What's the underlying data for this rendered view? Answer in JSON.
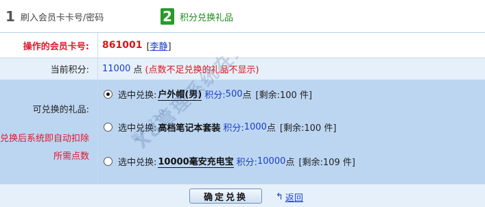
{
  "steps": [
    {
      "num": "1",
      "label": "刷入会员卡卡号/密码"
    },
    {
      "num": "2",
      "label": "积分兑换礼品"
    }
  ],
  "form": {
    "card_label": "操作的会员卡号:",
    "card_number": "861001",
    "member_bracket_open": "[",
    "member_name": "李静",
    "member_bracket_close": "]",
    "points_label": "当前积分:",
    "points_value": "11000",
    "points_unit": "点",
    "points_hint": "(点数不足兑换的礼品不显示)",
    "gift_label": "可兑换的礼品:",
    "auto_note": "兑换后系统即自动扣除所需点数",
    "options": [
      {
        "prefix": "选中兑换:",
        "name": "户外帽(男)",
        "points_label": "积分:",
        "points": "500",
        "unit": "点",
        "remain": "[剩余:100 件]",
        "checked": true
      },
      {
        "prefix": "选中兑换:",
        "name": "高档笔记本套装",
        "points_label": "积分:",
        "points": "1000",
        "unit": "点",
        "remain": "[剩余:100 件]",
        "checked": false
      },
      {
        "prefix": "选中兑换:",
        "name": "10000毫安充电宝",
        "points_label": "积分:",
        "points": "10000",
        "unit": "点",
        "remain": "[剩余:109 件]",
        "checked": false
      }
    ],
    "submit_label": "确定兑换",
    "back_label": "返回"
  },
  "watermark": {
    "text": "X8管理系统在线帮助文档-说明图",
    "version": "版本: 22.0"
  },
  "colors": {
    "accent_red": "#e0162b",
    "link_blue": "#1a3cc8",
    "step_green": "#2a9a2a",
    "options_bg": "#bcd6f2",
    "row_alt_bg": "#e6f0fa"
  },
  "icons": {
    "back": "return-arrow-icon",
    "radio_selected": "radio-checked-icon",
    "radio_empty": "radio-unchecked-icon"
  }
}
